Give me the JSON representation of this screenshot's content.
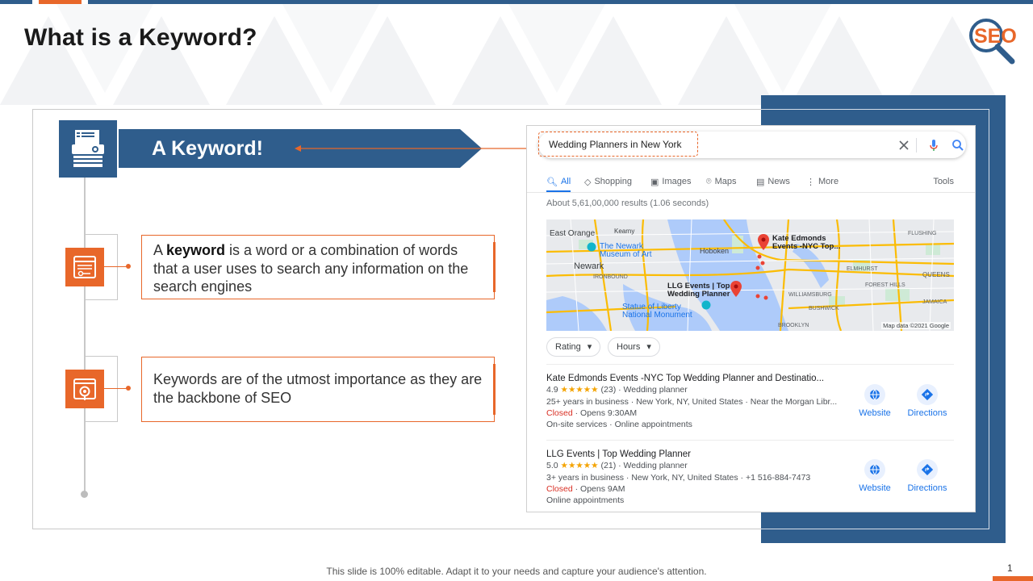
{
  "slide": {
    "title": "What is a Keyword?",
    "logo_text": "SEO",
    "footer": "This slide is 100% editable. Adapt it to your needs and capture your audience's attention.",
    "page_number": "1"
  },
  "banner": {
    "label": "A Keyword!"
  },
  "cards": [
    {
      "before": "A ",
      "bold": "keyword",
      "after": " is a word or a combination of words that a user uses to search any information on the search engines"
    },
    {
      "text": "Keywords are of the utmost importance as they are the backbone of SEO"
    }
  ],
  "google": {
    "query": "Wedding Planners in New York",
    "tabs": [
      "All",
      "Shopping",
      "Images",
      "Maps",
      "News",
      "More"
    ],
    "tools": "Tools",
    "results_count": "About 5,61,00,000 results (1.06 seconds)",
    "map": {
      "labels": [
        "East Orange",
        "Kearny",
        "The Newark Museum of Art",
        "Newark",
        "Hoboken",
        "Kate Edmonds Events -NYC Top...",
        "LLG Events | Top Wedding Planner",
        "Statue of Liberty National Monument",
        "FLUSHING",
        "ELMHURST",
        "FOREST HILLS",
        "QUEENS",
        "JAMAICA",
        "BUSHWICK",
        "BROOKLYN",
        "WILLIAMSBURG",
        "IRONBOUND"
      ],
      "attribution": "Map data ©2021 Google"
    },
    "chips": [
      "Rating",
      "Hours"
    ],
    "businesses": [
      {
        "name": "Kate Edmonds Events -NYC Top Wedding Planner and Destinatio...",
        "rating": "4.9",
        "stars": "★★★★★",
        "reviews": "(23)",
        "category": "· Wedding planner",
        "details": "25+ years in business · New York, NY, United States · Near the Morgan Libr...",
        "status": "Closed",
        "opens": "· Opens 9:30AM",
        "extra": "On-site services · Online appointments",
        "website": "Website",
        "directions": "Directions"
      },
      {
        "name": "LLG Events | Top Wedding Planner",
        "rating": "5.0",
        "stars": "★★★★★",
        "reviews": "(21)",
        "category": "· Wedding planner",
        "details": "3+ years in business · New York, NY, United States · +1 516-884-7473",
        "status": "Closed",
        "opens": "· Opens 9AM",
        "extra": "Online appointments",
        "website": "Website",
        "directions": "Directions"
      }
    ]
  }
}
